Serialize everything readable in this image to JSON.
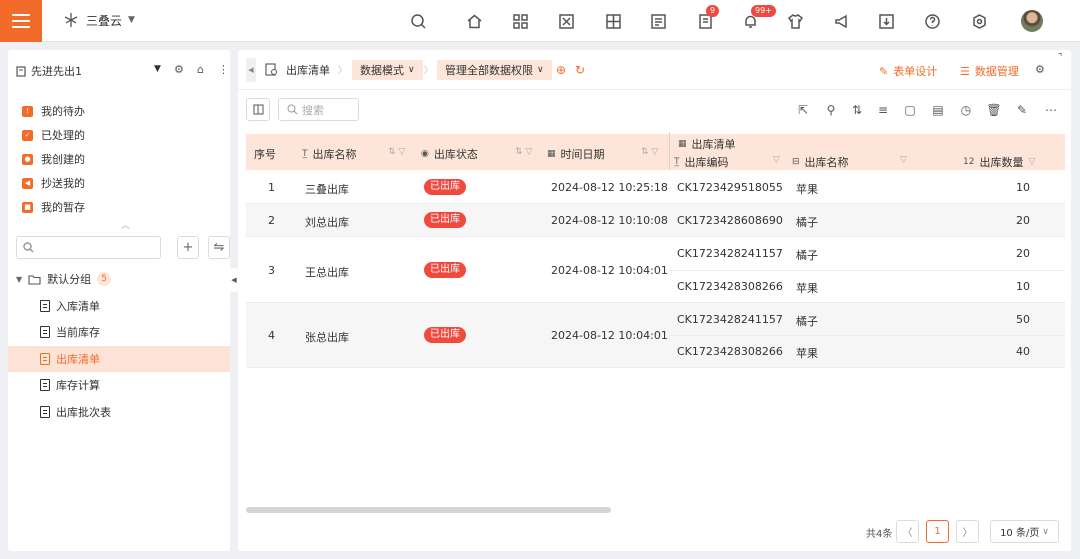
{
  "brand": {
    "name": "三叠云"
  },
  "top_badges": {
    "tasks": "9",
    "notifications": "99+"
  },
  "left": {
    "title": "先进先出1",
    "quick": [
      {
        "label": "我的待办"
      },
      {
        "label": "已处理的"
      },
      {
        "label": "我创建的"
      },
      {
        "label": "抄送我的"
      },
      {
        "label": "我的暂存"
      }
    ],
    "group": {
      "label": "默认分组",
      "count": "5"
    },
    "items": [
      {
        "label": "入库清单"
      },
      {
        "label": "当前库存"
      },
      {
        "label": "出库清单"
      },
      {
        "label": "库存计算"
      },
      {
        "label": "出库批次表"
      }
    ]
  },
  "crumbs": {
    "page": "出库清单",
    "mode": "数据模式",
    "perm": "管理全部数据权限"
  },
  "actions": {
    "form_design": "表单设计",
    "data_manage": "数据管理"
  },
  "search": {
    "placeholder": "搜索"
  },
  "table": {
    "headers": {
      "seq": "序号",
      "name": "出库名称",
      "status": "出库状态",
      "time": "时间日期",
      "group": "出库清单",
      "code": "出库编码",
      "sub_name": "出库名称",
      "qty": "出库数量"
    },
    "rows": [
      {
        "seq": "1",
        "name": "三叠出库",
        "status": "已出库",
        "time": "2024-08-12 10:25:18",
        "items": [
          {
            "code": "CK1723429518055",
            "name": "苹果",
            "qty": "10"
          }
        ]
      },
      {
        "seq": "2",
        "name": "刘总出库",
        "status": "已出库",
        "time": "2024-08-12 10:10:08",
        "items": [
          {
            "code": "CK1723428608690",
            "name": "橘子",
            "qty": "20"
          }
        ]
      },
      {
        "seq": "3",
        "name": "王总出库",
        "status": "已出库",
        "time": "2024-08-12 10:04:01",
        "items": [
          {
            "code": "CK1723428241157",
            "name": "橘子",
            "qty": "20"
          },
          {
            "code": "CK1723428308266",
            "name": "苹果",
            "qty": "10"
          }
        ]
      },
      {
        "seq": "4",
        "name": "张总出库",
        "status": "已出库",
        "time": "2024-08-12 10:04:01",
        "items": [
          {
            "code": "CK1723428241157",
            "name": "橘子",
            "qty": "50"
          },
          {
            "code": "CK1723428308266",
            "name": "苹果",
            "qty": "40"
          }
        ]
      }
    ]
  },
  "pager": {
    "total": "共4条",
    "current": "1",
    "size": "10 条/页"
  },
  "colors": {
    "accent": "#f26b2a",
    "status_red": "#f0493e",
    "header_bg": "#fde6d9"
  }
}
